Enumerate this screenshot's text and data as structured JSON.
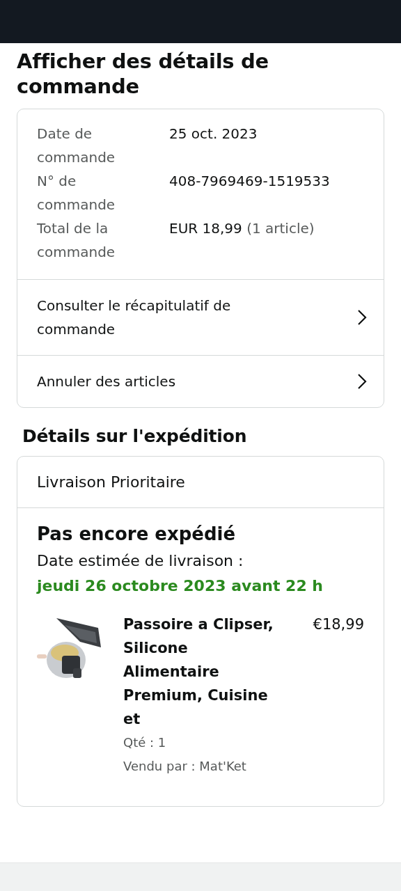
{
  "title": "Afficher des détails de commande",
  "order_summary": {
    "rows": [
      {
        "label": "Date de commande",
        "value": "25 oct. 2023"
      },
      {
        "label": "N° de commande",
        "value": "408-7969469-1519533"
      },
      {
        "label": "Total de la commande",
        "value": "EUR 18,99",
        "note": "(1 article)"
      }
    ],
    "links": [
      {
        "label": "Consulter le récapitulatif de commande"
      },
      {
        "label": "Annuler des articles"
      }
    ]
  },
  "shipment_heading": "Détails sur l'expédition",
  "shipment": {
    "method": "Livraison Prioritaire",
    "status": "Pas encore expédié",
    "estimate_label": "Date estimée de livraison :",
    "estimate_date": "jeudi 26 octobre 2023 avant 22 h",
    "items": [
      {
        "title": "Passoire a Clipser, Silicone Alimentaire Premium, Cuisine et",
        "price": "€18,99",
        "quantity": "Qté : 1",
        "seller": "Vendu par : Mat'Ket"
      }
    ]
  }
}
